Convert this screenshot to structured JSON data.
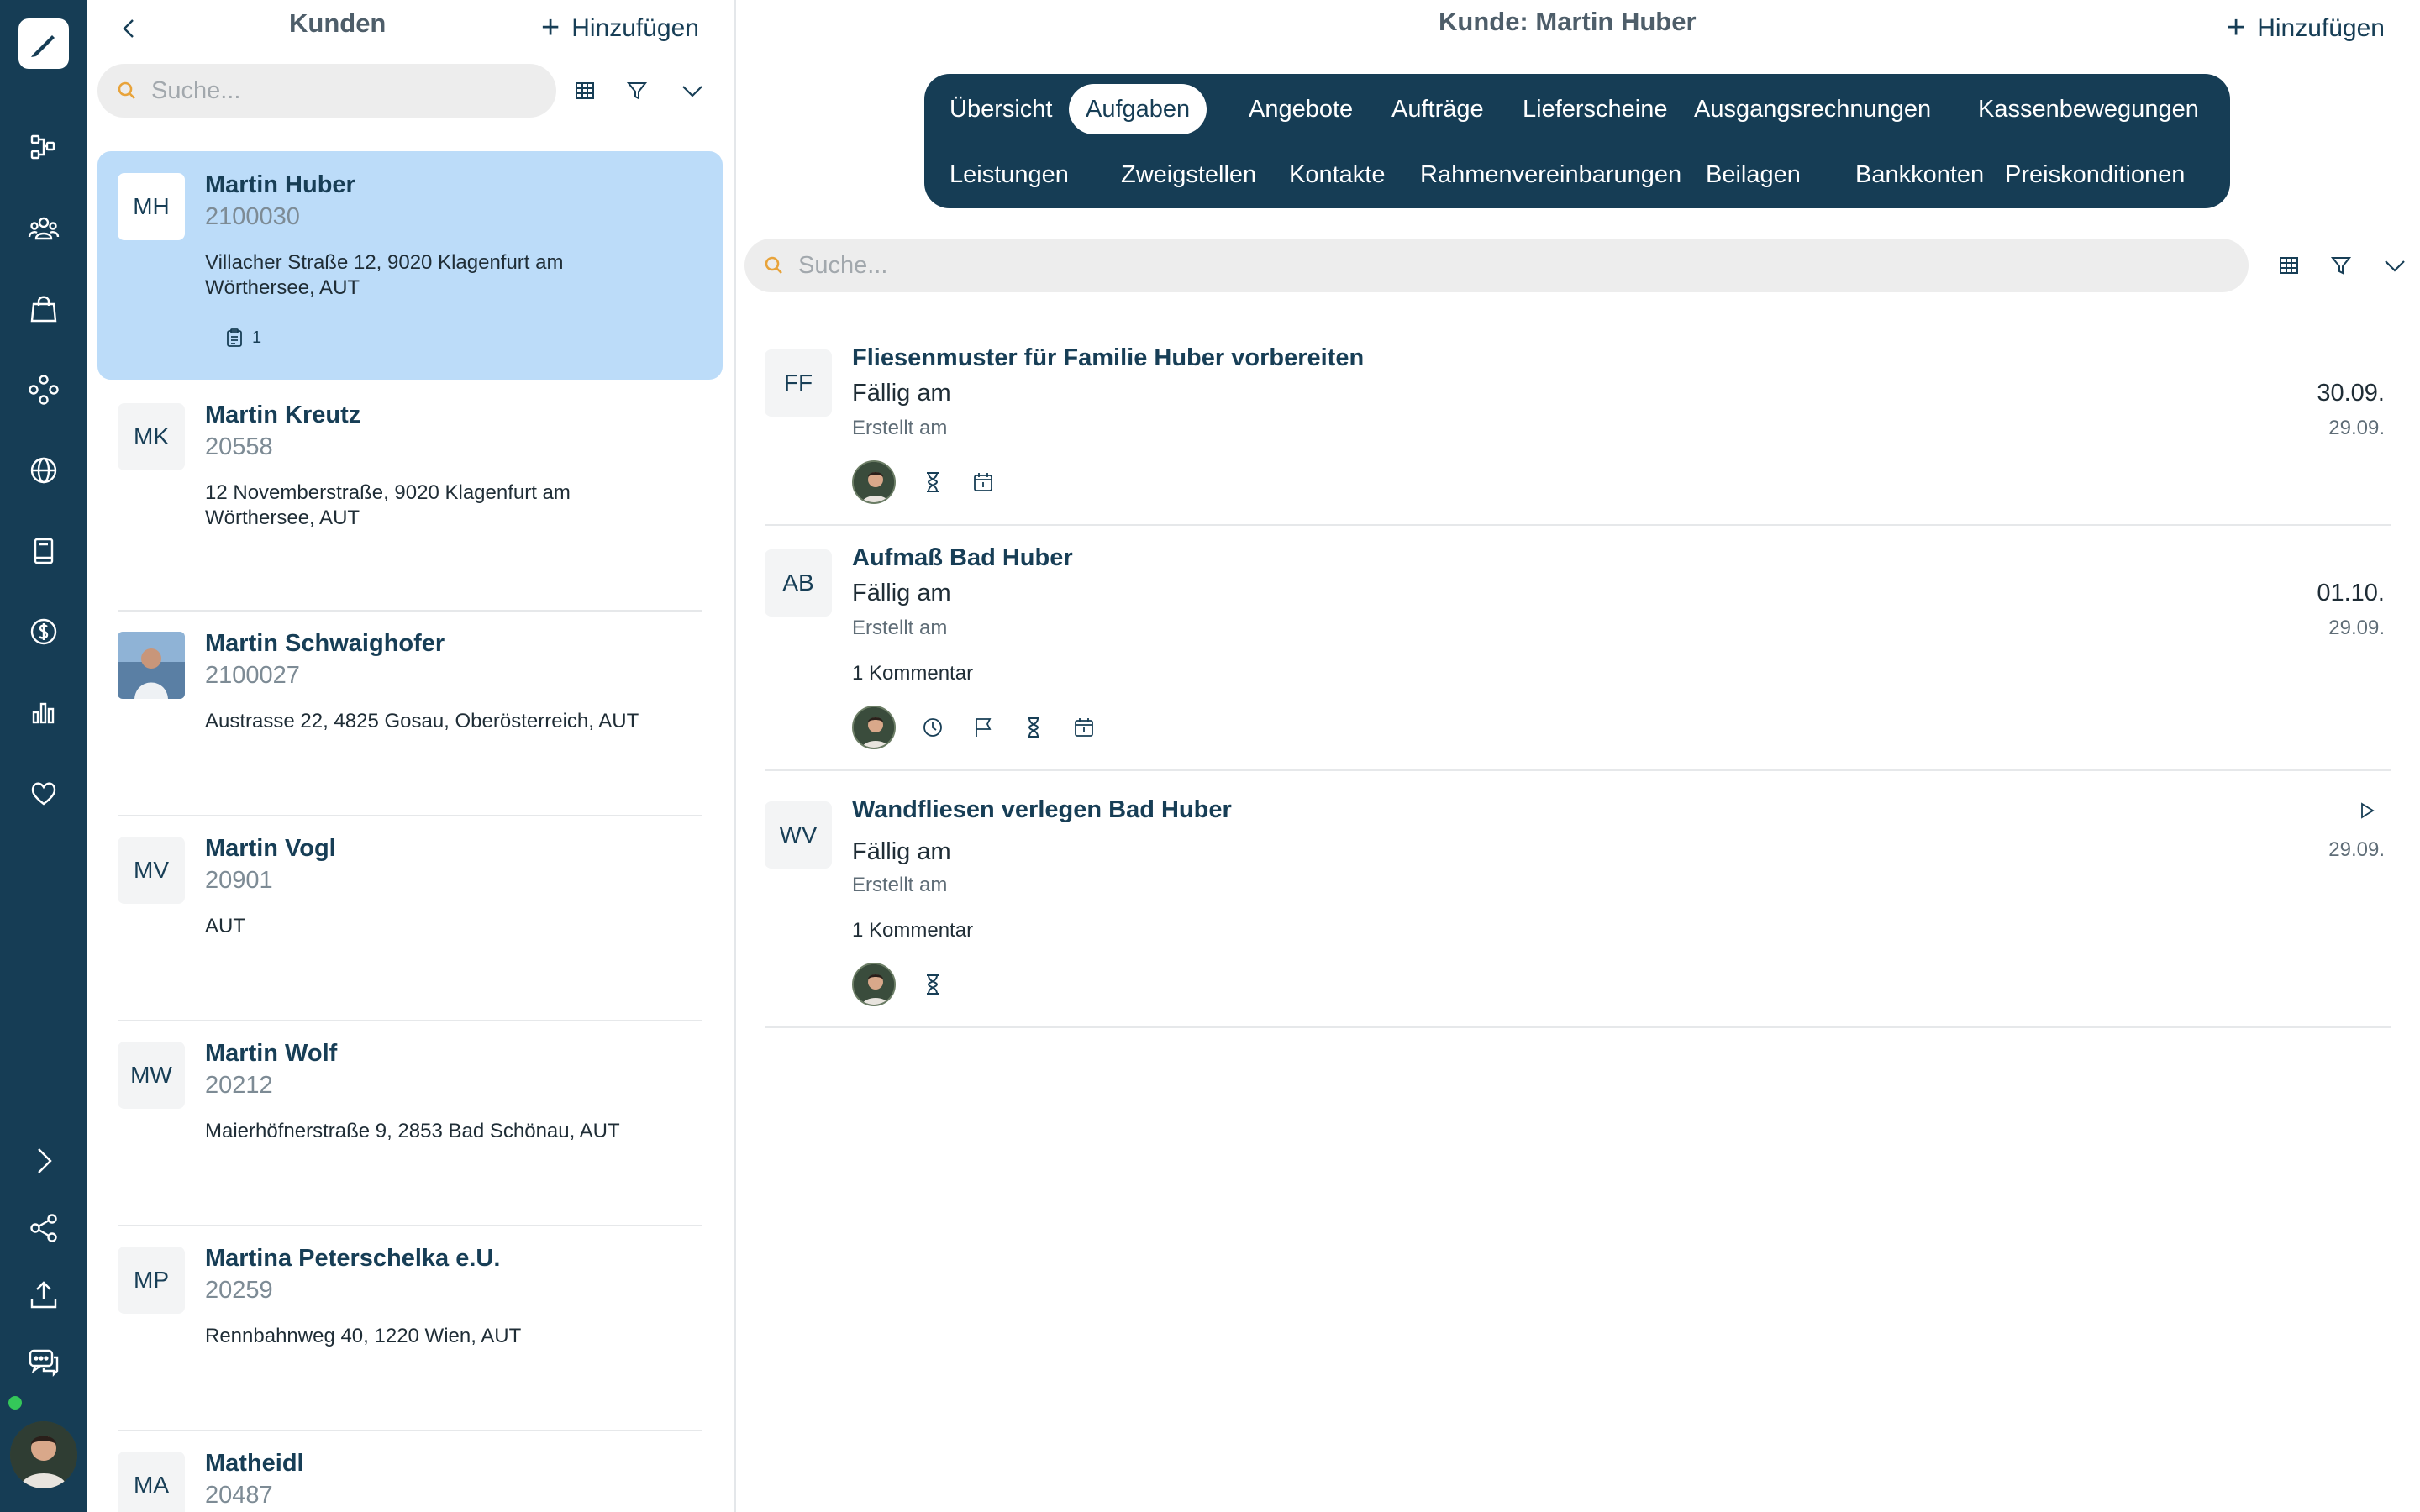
{
  "rail": {
    "icons": [
      "pencil-logo-icon",
      "workflow-icon",
      "people-icon",
      "shopping-bag-icon",
      "network-icon",
      "globe-icon",
      "book-icon",
      "dollar-icon",
      "bar-chart-icon",
      "heart-icon",
      "chevron-right-icon",
      "share-icon",
      "upload-icon",
      "chat-icon"
    ],
    "status": "online"
  },
  "list": {
    "title": "Kunden",
    "add_label": "Hinzufügen",
    "search_placeholder": "Suche...",
    "customers": [
      {
        "initials": "MH",
        "name": "Martin Huber",
        "number": "2100030",
        "address": "Villacher Straße 12, 9020 Klagenfurt am Wörthersee, AUT",
        "badge_count": "1",
        "selected": true
      },
      {
        "initials": "MK",
        "name": "Martin Kreutz",
        "number": "20558",
        "address": "12 Novemberstraße, 9020 Klagenfurt am Wörthersee, AUT"
      },
      {
        "initials": "",
        "name": "Martin Schwaighofer",
        "number": "2100027",
        "address": "Austrasse 22, 4825 Gosau, Oberösterreich, AUT"
      },
      {
        "initials": "MV",
        "name": "Martin Vogl",
        "number": "20901",
        "address": "AUT"
      },
      {
        "initials": "MW",
        "name": "Martin Wolf",
        "number": "20212",
        "address": "Maierhöfnerstraße 9, 2853 Bad Schönau, AUT"
      },
      {
        "initials": "MP",
        "name": "Martina Peterschelka e.U.",
        "number": "20259",
        "address": "Rennbahnweg 40, 1220 Wien, AUT"
      },
      {
        "initials": "MA",
        "name": "Matheidl",
        "number": "20487",
        "address": ""
      }
    ]
  },
  "detail": {
    "title": "Kunde: Martin Huber",
    "add_label": "Hinzufügen",
    "search_placeholder": "Suche...",
    "tabs": [
      "Übersicht",
      "Aufgaben",
      "Angebote",
      "Aufträge",
      "Lieferscheine",
      "Ausgangsrechnungen",
      "Kassenbewegungen",
      "Leistungen",
      "Zweigstellen",
      "Kontakte",
      "Rahmenvereinbarungen",
      "Beilagen",
      "Bankkonten",
      "Preiskonditionen"
    ],
    "active_tab": "Aufgaben",
    "tasks": [
      {
        "initials": "FF",
        "title": "Fliesenmuster für Familie Huber vorbereiten",
        "due_label": "Fällig am",
        "created_label": "Erstellt am",
        "due": "30.09.",
        "created": "29.09.",
        "comment": "",
        "icons": [
          "hourglass-icon",
          "calendar-icon"
        ]
      },
      {
        "initials": "AB",
        "title": "Aufmaß Bad Huber",
        "due_label": "Fällig am",
        "created_label": "Erstellt am",
        "due": "01.10.",
        "created": "29.09.",
        "comment": "1 Kommentar",
        "icons": [
          "clock-icon",
          "flag-icon",
          "hourglass-icon",
          "calendar-icon"
        ]
      },
      {
        "initials": "WV",
        "title": "Wandfliesen verlegen Bad Huber",
        "due_label": "Fällig am",
        "created_label": "Erstellt am",
        "due": "",
        "created": "29.09.",
        "comment": "1 Kommentar",
        "icons": [
          "hourglass-icon"
        ]
      }
    ]
  },
  "colors": {
    "navy": "#163d55",
    "selected": "#bcdcf9",
    "search_bg": "#ededed",
    "search_icon": "#e8a33a"
  }
}
